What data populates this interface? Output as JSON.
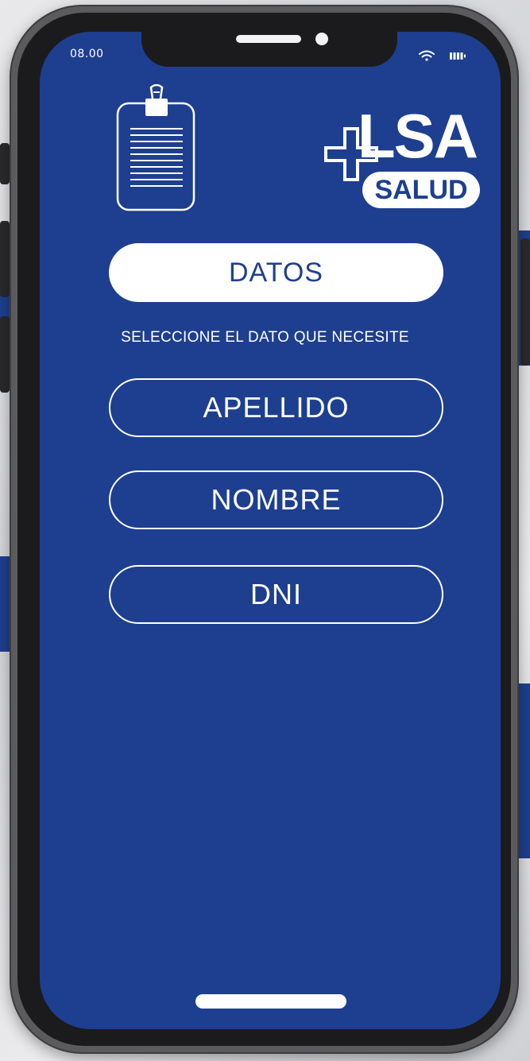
{
  "status_bar": {
    "time": "08.00",
    "icons": [
      "wifi-icon",
      "battery-icon"
    ]
  },
  "header": {
    "clipboard_icon": "clipboard-icon",
    "logo": {
      "main_text": "LSA",
      "sub_text": "SALUD",
      "symbol": "plus"
    },
    "title": "DATOS"
  },
  "instruction": "SELECCIONE EL DATO QUE NECESITE",
  "options": [
    {
      "label": "APELLIDO"
    },
    {
      "label": "NOMBRE"
    },
    {
      "label": "DNI"
    }
  ],
  "colors": {
    "screen_background": "#1e3f8f",
    "foreground": "#ffffff",
    "device_frame": "#5b5b5e"
  }
}
